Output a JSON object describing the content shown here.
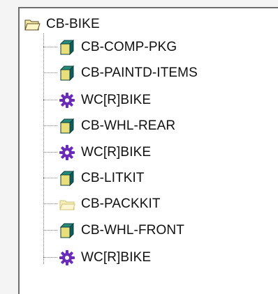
{
  "tree": {
    "root": {
      "label": "CB-BIKE",
      "icon": "open-folder-icon"
    },
    "children": [
      {
        "label": "CB-COMP-PKG",
        "icon": "component-cube-icon"
      },
      {
        "label": "CB-PAINTD-ITEMS",
        "icon": "component-cube-icon"
      },
      {
        "label": "WC[R]BIKE",
        "icon": "work-center-gear-icon"
      },
      {
        "label": "CB-WHL-REAR",
        "icon": "component-cube-icon"
      },
      {
        "label": "WC[R]BIKE",
        "icon": "work-center-gear-icon"
      },
      {
        "label": "CB-LITKIT",
        "icon": "component-cube-icon"
      },
      {
        "label": "CB-PACKKIT",
        "icon": "folder-icon"
      },
      {
        "label": "CB-WHL-FRONT",
        "icon": "component-cube-icon"
      },
      {
        "label": "WC[R]BIKE",
        "icon": "work-center-gear-icon"
      }
    ]
  },
  "colors": {
    "cube_face": "#e8df7a",
    "cube_edge": "#0f5c5c",
    "gear": "#6a2bb8",
    "folder": "#f3e8a6"
  }
}
